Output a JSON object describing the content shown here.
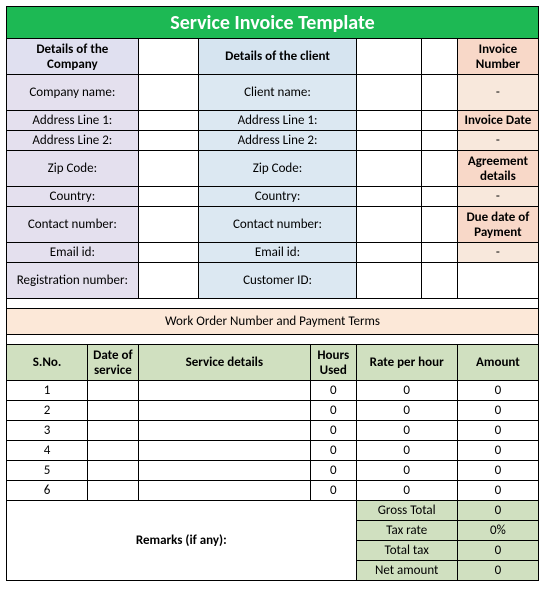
{
  "title": "Service Invoice Template",
  "headers": {
    "company": "Details of the Company",
    "client": "Details of the client",
    "invoice_number": "Invoice Number"
  },
  "company_labels": {
    "name": "Company name:",
    "addr1": "Address Line 1:",
    "addr2": "Address Line 2:",
    "zip": "Zip Code:",
    "country": "Country:",
    "contact": "Contact number:",
    "email": "Email id:",
    "reg": "Registration number:"
  },
  "client_labels": {
    "name": "Client name:",
    "addr1": "Address Line 1:",
    "addr2": "Address Line 2:",
    "zip": "Zip Code:",
    "country": "Country:",
    "contact": "Contact number:",
    "email": "Email id:",
    "cust_id": "Customer ID:"
  },
  "inv_section": {
    "invoice_number_val": "-",
    "invoice_date_lbl": "Invoice Date",
    "invoice_date_val": "-",
    "agreement_lbl": "Agreement details",
    "agreement_val": "-",
    "due_lbl": "Due date of Payment",
    "due_val": "-"
  },
  "work_order": "Work Order Number and Payment Terms",
  "svc_hdr": {
    "sno": "S.No.",
    "date": "Date of service",
    "details": "Service details",
    "hours": "Hours Used",
    "rate": "Rate per hour",
    "amount": "Amount"
  },
  "svc_rows": [
    {
      "sno": "1",
      "date": "",
      "details": "",
      "hours": "0",
      "rate": "0",
      "amount": "0"
    },
    {
      "sno": "2",
      "date": "",
      "details": "",
      "hours": "0",
      "rate": "0",
      "amount": "0"
    },
    {
      "sno": "3",
      "date": "",
      "details": "",
      "hours": "0",
      "rate": "0",
      "amount": "0"
    },
    {
      "sno": "4",
      "date": "",
      "details": "",
      "hours": "0",
      "rate": "0",
      "amount": "0"
    },
    {
      "sno": "5",
      "date": "",
      "details": "",
      "hours": "0",
      "rate": "0",
      "amount": "0"
    },
    {
      "sno": "6",
      "date": "",
      "details": "",
      "hours": "0",
      "rate": "0",
      "amount": "0"
    }
  ],
  "remarks_label": "Remarks (if any):",
  "totals": {
    "gross_lbl": "Gross Total",
    "gross_val": "0",
    "taxrate_lbl": "Tax rate",
    "taxrate_val": "0%",
    "totaltax_lbl": "Total tax",
    "totaltax_val": "0",
    "net_lbl": "Net amount",
    "net_val": "0"
  }
}
